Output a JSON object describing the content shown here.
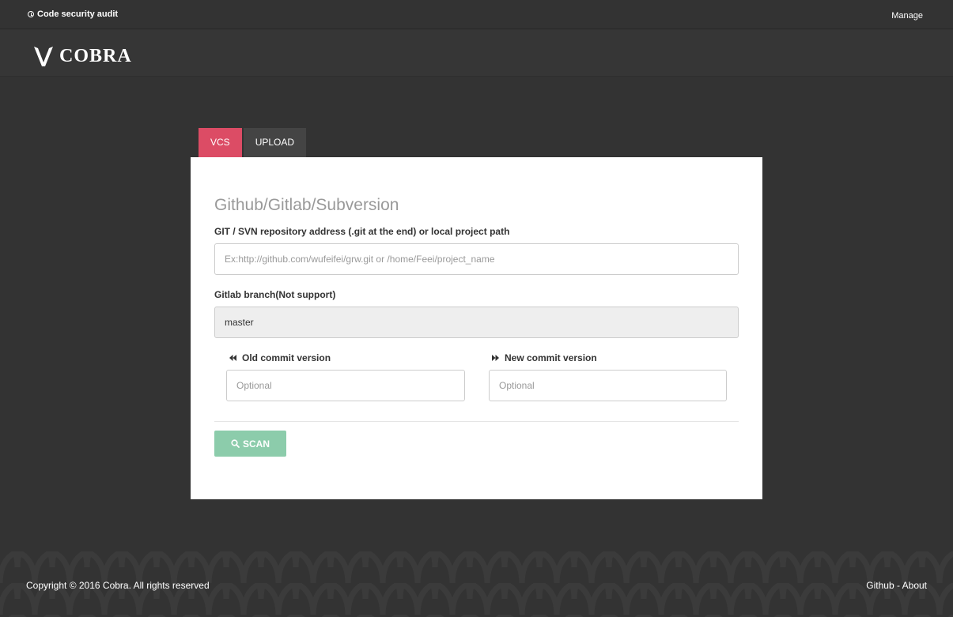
{
  "topbar": {
    "title": "Code security audit",
    "manage_label": "Manage"
  },
  "brand": {
    "name": "COBRA"
  },
  "tabs": [
    {
      "label": "VCS",
      "active": true
    },
    {
      "label": "UPLOAD",
      "active": false
    }
  ],
  "form": {
    "heading": "Github/Gitlab/Subversion",
    "repo_label": "GIT / SVN repository address (.git at the end) or local project path",
    "repo_placeholder": "Ex:http://github.com/wufeifei/grw.git or /home/Feei/project_name",
    "branch_label": "Gitlab branch(Not support)",
    "branch_value": "master",
    "old_commit_label": "Old commit version",
    "old_commit_placeholder": "Optional",
    "new_commit_label": "New commit version",
    "new_commit_placeholder": "Optional",
    "scan_label": "SCAN"
  },
  "footer": {
    "copyright": "Copyright © 2016 Cobra. All rights reserved",
    "github_link": "Github",
    "separator": " - ",
    "about_link": "About"
  },
  "colors": {
    "active_tab": "#dc4c65",
    "scan_button": "#8cccab",
    "background": "#333333"
  },
  "icons": {
    "topbar": "clock-icon",
    "old_commit": "rewind-icon",
    "new_commit": "fast-forward-icon",
    "scan": "search-icon"
  }
}
